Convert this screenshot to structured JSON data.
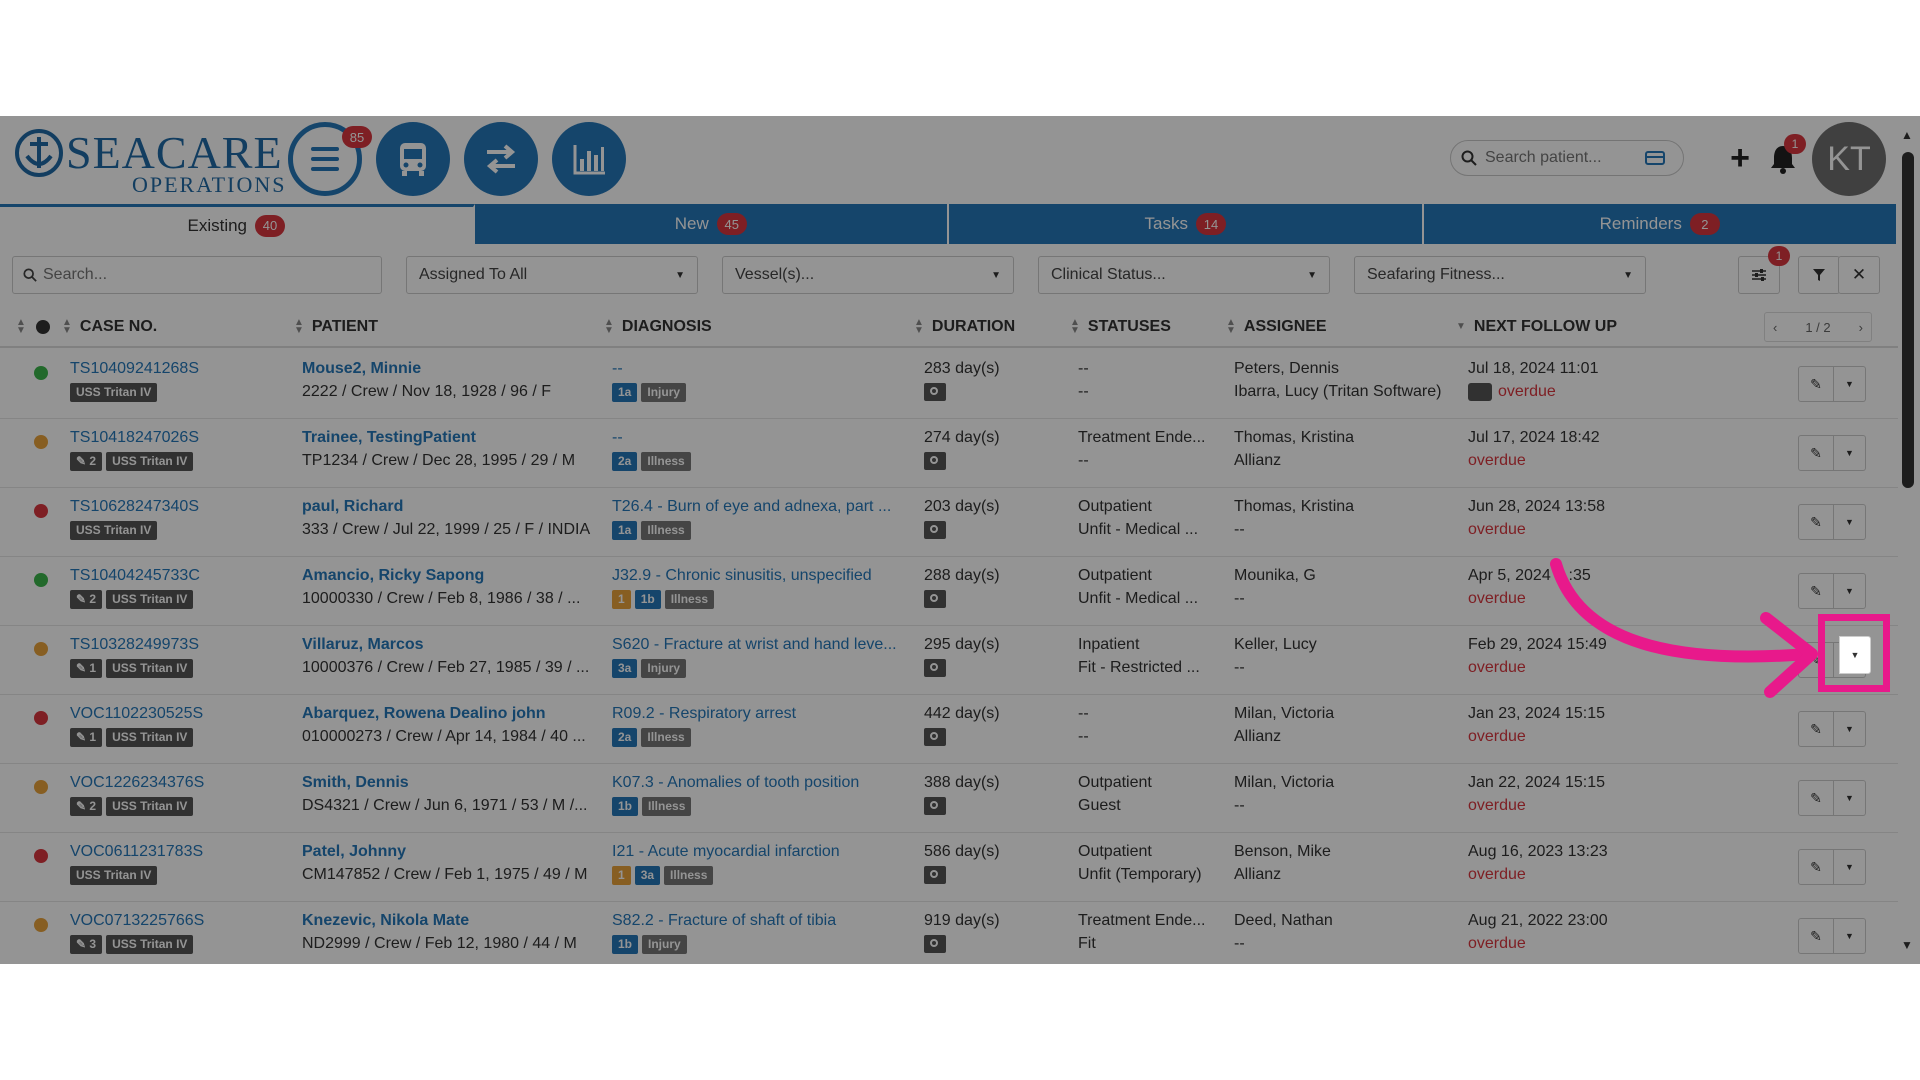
{
  "header": {
    "logo_main": "SEACARE",
    "logo_sub": "OPERATIONS",
    "menu_badge": "85",
    "search_placeholder": "Search patient...",
    "bell_badge": "1",
    "avatar_initials": "KT"
  },
  "tabs": [
    {
      "label": "Existing",
      "count": "40",
      "active": true
    },
    {
      "label": "New",
      "count": "45",
      "active": false
    },
    {
      "label": "Tasks",
      "count": "14",
      "active": false
    },
    {
      "label": "Reminders",
      "count": "2",
      "active": false
    }
  ],
  "filters": {
    "search_placeholder": "Search...",
    "assigned": "Assigned To All",
    "vessels": "Vessel(s)...",
    "clinical_status": "Clinical Status...",
    "seafaring_fitness": "Seafaring Fitness...",
    "settings_badge": "1"
  },
  "columns": {
    "case_no": "CASE NO.",
    "patient": "PATIENT",
    "diagnosis": "DIAGNOSIS",
    "duration": "DURATION",
    "statuses": "STATUSES",
    "assignee": "ASSIGNEE",
    "next_follow_up": "NEXT FOLLOW UP",
    "pager": "1 / 2"
  },
  "colors": {
    "green": "#3cb54a",
    "orange": "#e8a33c",
    "red": "#d9363e",
    "brand": "#2577b8",
    "highlight": "#e8198b"
  },
  "rows": [
    {
      "dot": "green",
      "case": "TS10409241268S",
      "tags": [
        "USS Tritan IV"
      ],
      "patient": "Mouse2, Minnie",
      "details": "2222 / Crew / Nov 18, 1928 / 96 / F",
      "diagnosis": "--",
      "dtags": [
        [
          "1a",
          "blue"
        ],
        [
          "Injury",
          "grey"
        ]
      ],
      "duration": "283 day(s)",
      "status1": "--",
      "status2": "--",
      "assignee1": "Peters, Dennis",
      "assignee2": "Ibarra, Lucy (Tritan Software)",
      "followup": "Jul 18, 2024 11:01",
      "followup2": "overdue",
      "chat": true
    },
    {
      "dot": "orange",
      "case": "TS10418247026S",
      "tags": [
        "✎ 2",
        "USS Tritan IV"
      ],
      "patient": "Trainee, TestingPatient",
      "details": "TP1234 / Crew / Dec 28, 1995 / 29 / M",
      "diagnosis": "--",
      "dtags": [
        [
          "2a",
          "blue"
        ],
        [
          "Illness",
          "grey"
        ]
      ],
      "duration": "274 day(s)",
      "status1": "Treatment Ende...",
      "status2": "--",
      "assignee1": "Thomas, Kristina",
      "assignee2": "Allianz",
      "followup": "Jul 17, 2024 18:42",
      "followup2": "overdue",
      "chat": false
    },
    {
      "dot": "red",
      "case": "TS10628247340S",
      "tags": [
        "USS Tritan IV"
      ],
      "patient": "paul, Richard",
      "details": "333 / Crew / Jul 22, 1999 / 25 / F / INDIA",
      "diagnosis": "T26.4 - Burn of eye and adnexa, part ...",
      "dtags": [
        [
          "1a",
          "blue"
        ],
        [
          "Illness",
          "grey"
        ]
      ],
      "duration": "203 day(s)",
      "status1": "Outpatient",
      "status2": "Unfit - Medical ...",
      "assignee1": "Thomas, Kristina",
      "assignee2": "--",
      "followup": "Jun 28, 2024 13:58",
      "followup2": "overdue",
      "chat": false
    },
    {
      "dot": "green",
      "case": "TS10404245733C",
      "tags": [
        "✎ 2",
        "USS Tritan IV"
      ],
      "patient": "Amancio, Ricky Sapong",
      "details": "10000330 / Crew / Feb 8, 1986 / 38 / ...",
      "diagnosis": "J32.9 - Chronic sinusitis, unspecified",
      "dtags": [
        [
          "1",
          "orange"
        ],
        [
          "1b",
          "blue"
        ],
        [
          "Illness",
          "grey"
        ]
      ],
      "duration": "288 day(s)",
      "status1": "Outpatient",
      "status2": "Unfit - Medical ...",
      "assignee1": "Mounika, G",
      "assignee2": "--",
      "followup": "Apr 5, 2024 1 :35",
      "followup2": "overdue",
      "chat": false
    },
    {
      "dot": "orange",
      "case": "TS10328249973S",
      "tags": [
        "✎ 1",
        "USS Tritan IV"
      ],
      "patient": "Villaruz, Marcos",
      "details": "10000376 / Crew / Feb 27, 1985 / 39 / ...",
      "diagnosis": "S620 - Fracture at wrist and hand leve...",
      "dtags": [
        [
          "3a",
          "blue"
        ],
        [
          "Injury",
          "grey"
        ]
      ],
      "duration": "295 day(s)",
      "status1": "Inpatient",
      "status2": "Fit - Restricted ...",
      "assignee1": "Keller, Lucy",
      "assignee2": "--",
      "followup": "Feb 29, 2024 15:49",
      "followup2": "overdue",
      "chat": false
    },
    {
      "dot": "red",
      "case": "VOC1102230525S",
      "tags": [
        "✎ 1",
        "USS Tritan IV"
      ],
      "patient": "Abarquez, Rowena Dealino john",
      "details": "010000273 / Crew / Apr 14, 1984 / 40 ...",
      "diagnosis": "R09.2 - Respiratory arrest",
      "dtags": [
        [
          "2a",
          "blue"
        ],
        [
          "Illness",
          "grey"
        ]
      ],
      "duration": "442 day(s)",
      "status1": "--",
      "status2": "--",
      "assignee1": "Milan, Victoria",
      "assignee2": "Allianz",
      "followup": "Jan 23, 2024 15:15",
      "followup2": "overdue",
      "chat": false
    },
    {
      "dot": "orange",
      "case": "VOC1226234376S",
      "tags": [
        "✎ 2",
        "USS Tritan IV"
      ],
      "patient": "Smith, Dennis",
      "details": "DS4321 / Crew / Jun 6, 1971 / 53 / M /...",
      "diagnosis": "K07.3 - Anomalies of tooth position",
      "dtags": [
        [
          "1b",
          "blue"
        ],
        [
          "Illness",
          "grey"
        ]
      ],
      "duration": "388 day(s)",
      "status1": "Outpatient",
      "status2": "Guest",
      "assignee1": "Milan, Victoria",
      "assignee2": "--",
      "followup": "Jan 22, 2024 15:15",
      "followup2": "overdue",
      "chat": false
    },
    {
      "dot": "red",
      "case": "VOC0611231783S",
      "tags": [
        "USS Tritan IV"
      ],
      "patient": "Patel, Johnny",
      "details": "CM147852 / Crew / Feb 1, 1975 / 49 / M",
      "diagnosis": "I21 - Acute myocardial infarction",
      "dtags": [
        [
          "1",
          "orange"
        ],
        [
          "3a",
          "blue"
        ],
        [
          "Illness",
          "grey"
        ]
      ],
      "duration": "586 day(s)",
      "status1": "Outpatient",
      "status2": "Unfit (Temporary)",
      "assignee1": "Benson, Mike",
      "assignee2": "Allianz",
      "followup": "Aug 16, 2023 13:23",
      "followup2": "overdue",
      "chat": false
    },
    {
      "dot": "orange",
      "case": "VOC0713225766S",
      "tags": [
        "✎ 3",
        "USS Tritan IV"
      ],
      "patient": "Knezevic, Nikola Mate",
      "details": "ND2999 / Crew / Feb 12, 1980 / 44 / M",
      "diagnosis": "S82.2 - Fracture of shaft of tibia",
      "dtags": [
        [
          "1b",
          "blue"
        ],
        [
          "Injury",
          "grey"
        ]
      ],
      "duration": "919 day(s)",
      "status1": "Treatment Ende...",
      "status2": "Fit",
      "assignee1": "Deed, Nathan",
      "assignee2": "--",
      "followup": "Aug 21, 2022 23:00",
      "followup2": "overdue",
      "chat": false
    }
  ]
}
